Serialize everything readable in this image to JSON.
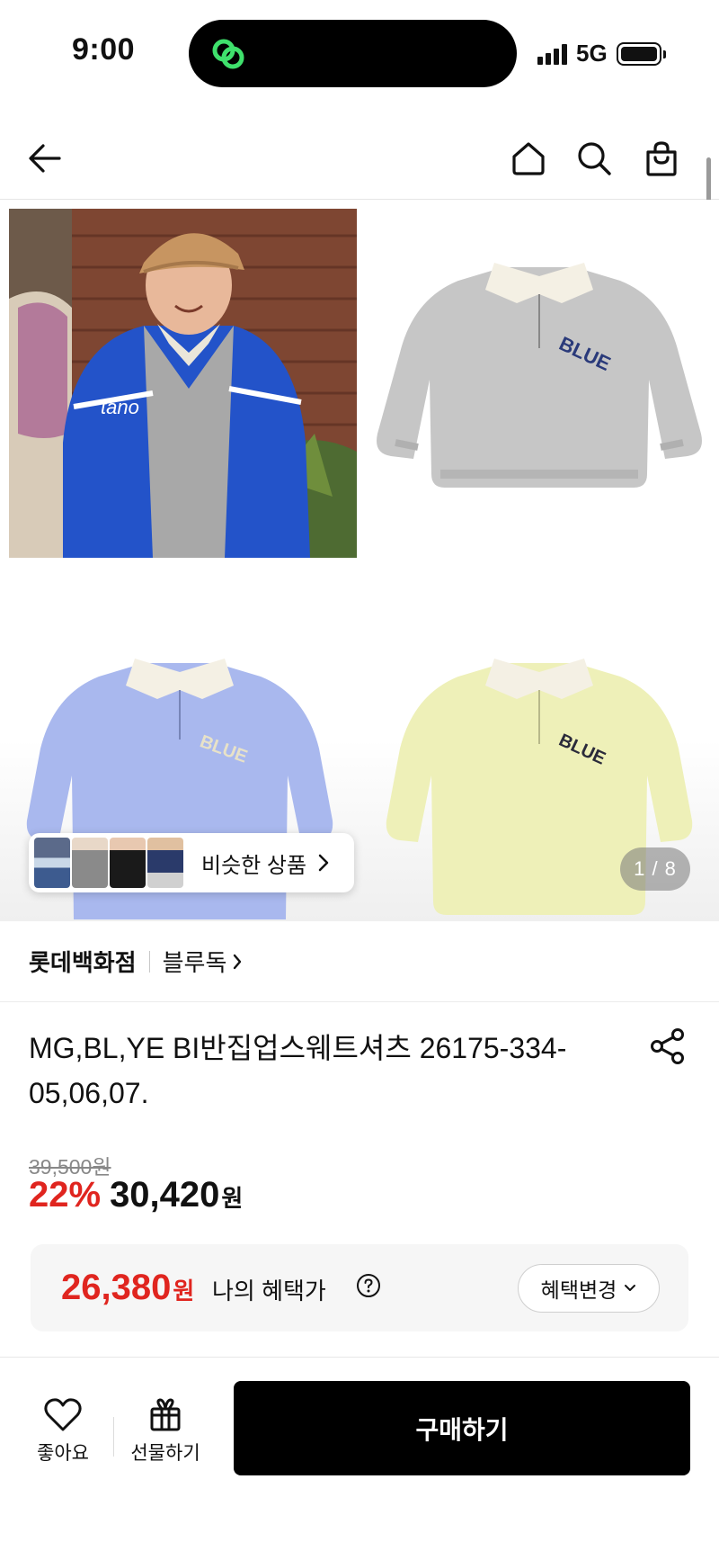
{
  "status_bar": {
    "time": "9:00",
    "network": "5G",
    "icons": [
      "dynamic-island-app-icon",
      "signal-icon",
      "battery-icon"
    ]
  },
  "header": {
    "icons": [
      "back-arrow-icon",
      "home-icon",
      "search-icon",
      "shopping-bag-icon"
    ]
  },
  "gallery": {
    "page_indicator": "1 / 8",
    "similar_products_label": "비슷한 상품",
    "images": [
      "child-model-photo",
      "gray-sweatshirt",
      "blue-sweatshirt",
      "yellow-sweatshirt"
    ],
    "colors": {
      "gray": "#c6c6c6",
      "blue": "#a9b8ee",
      "yellow": "#eef0b8",
      "collar": "#f4f0e4",
      "logo": "#2a3a7a"
    }
  },
  "store": {
    "store_name": "롯데백화점",
    "brand_name": "블루독"
  },
  "product": {
    "title": "MG,BL,YE BI반집업스웨트셔츠 26175-334-05,06,07.",
    "original_price": "39,500원",
    "discount_rate": "22%",
    "sale_price": "30,420",
    "sale_price_unit": "원"
  },
  "benefit": {
    "price": "26,380",
    "price_unit": "원",
    "label": "나의 혜택가",
    "change_button": "혜택변경"
  },
  "bottom_bar": {
    "like_label": "좋아요",
    "gift_label": "선물하기",
    "buy_label": "구매하기"
  },
  "colors": {
    "discount_red": "#e0251f",
    "buy_button": "#000000"
  }
}
